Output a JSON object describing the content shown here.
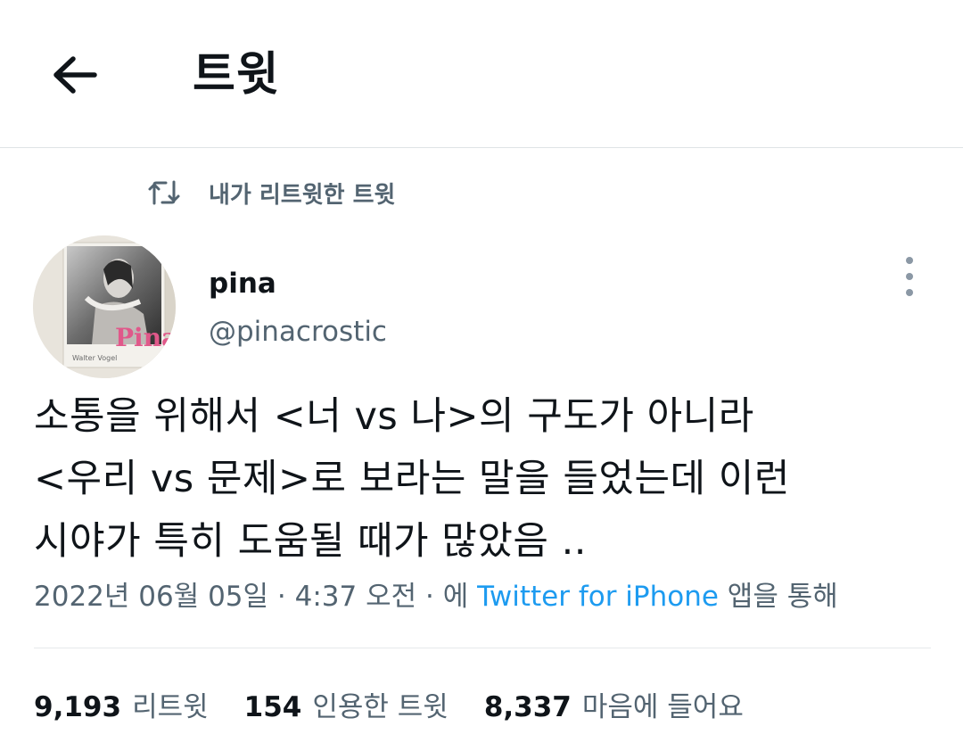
{
  "header": {
    "title": "트윗",
    "back_icon": "arrow-left-icon"
  },
  "retweet_context": {
    "icon": "retweet-icon",
    "label": "내가 리트윗한 트윗"
  },
  "author": {
    "name": "pina",
    "handle": "@pinacrostic",
    "avatar_book_title": "Pina",
    "avatar_book_author": "Walter Vogel"
  },
  "tweet": {
    "lines": [
      "소통을 위해서 <너 vs 나>의 구도가 아니라",
      "<우리 vs 문제>로 보라는 말을 들었는데 이런",
      "시야가 특히 도움될 때가 많았음 .."
    ]
  },
  "meta": {
    "date": "2022년 06월 05일",
    "separator1": " · ",
    "time": "4:37 오전",
    "separator2": " · ",
    "via_prefix": "에 ",
    "source": "Twitter for iPhone",
    "via_suffix": " 앱을 통해"
  },
  "stats": {
    "retweets_count": "9,193",
    "retweets_label": "리트윗",
    "quotes_count": "154",
    "quotes_label": "인용한 트윗",
    "likes_count": "8,337",
    "likes_label": "마음에 들어요"
  },
  "colors": {
    "text": "#0f1419",
    "secondary": "#536471",
    "link": "#1d9bf0",
    "divider": "#e6e9eb"
  }
}
